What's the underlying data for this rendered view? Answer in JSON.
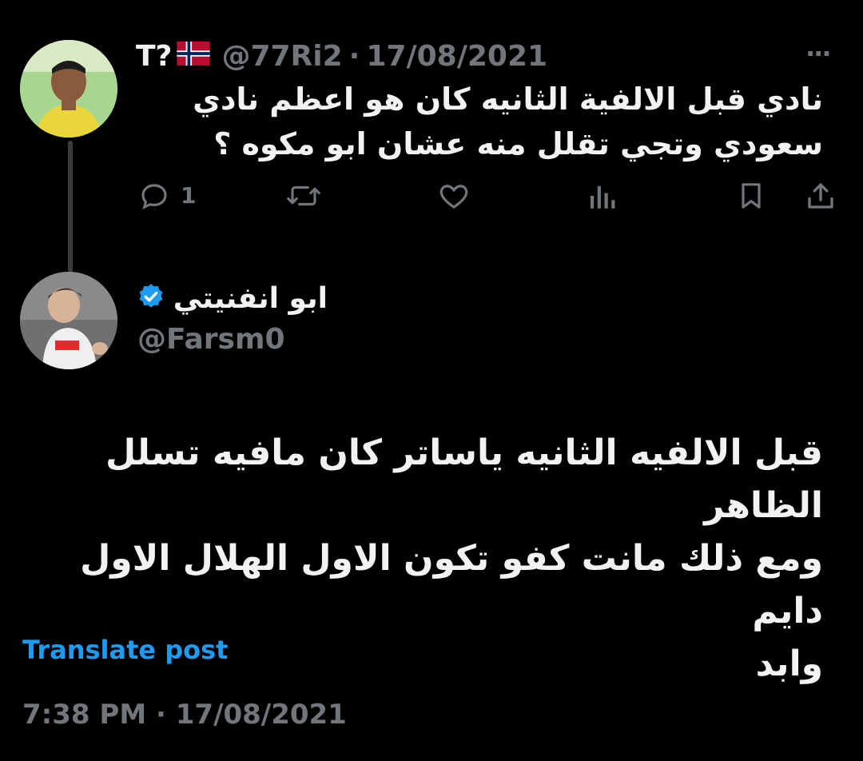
{
  "reply_to_post": {
    "display_name": "T?",
    "flag": "🇳🇴",
    "handle": "@77Ri2",
    "separator": "·",
    "date": "17/08/2021",
    "more": "···",
    "text_line_1": "نادي قبل الالفية الثانيه كان هو اعظم نادي",
    "text_line_2": "سعودي وتجي تقلل منه عشان ابو مكوه ؟",
    "reply_count": "1"
  },
  "main_post": {
    "display_name": "ابو انفنيتي",
    "handle": "@Farsm0",
    "text_line_1": "قبل الالفيه الثانيه ياساتر كان مافيه تسلل الظاهر",
    "text_line_2": "ومع ذلك مانت كفو تكون الاول الهلال الاول دايم",
    "text_line_3": "وابد",
    "translate_label": "Translate post",
    "timestamp": "7:38 PM · 17/08/2021"
  },
  "colors": {
    "background": "#000000",
    "text": "#e7e9ea",
    "muted": "#71767b",
    "link": "#1d9bf0",
    "verified": "#1d9bf0"
  },
  "icons": [
    "reply-icon",
    "repost-icon",
    "like-icon",
    "views-icon",
    "bookmark-icon",
    "share-icon",
    "verified-badge-icon",
    "more-icon"
  ]
}
